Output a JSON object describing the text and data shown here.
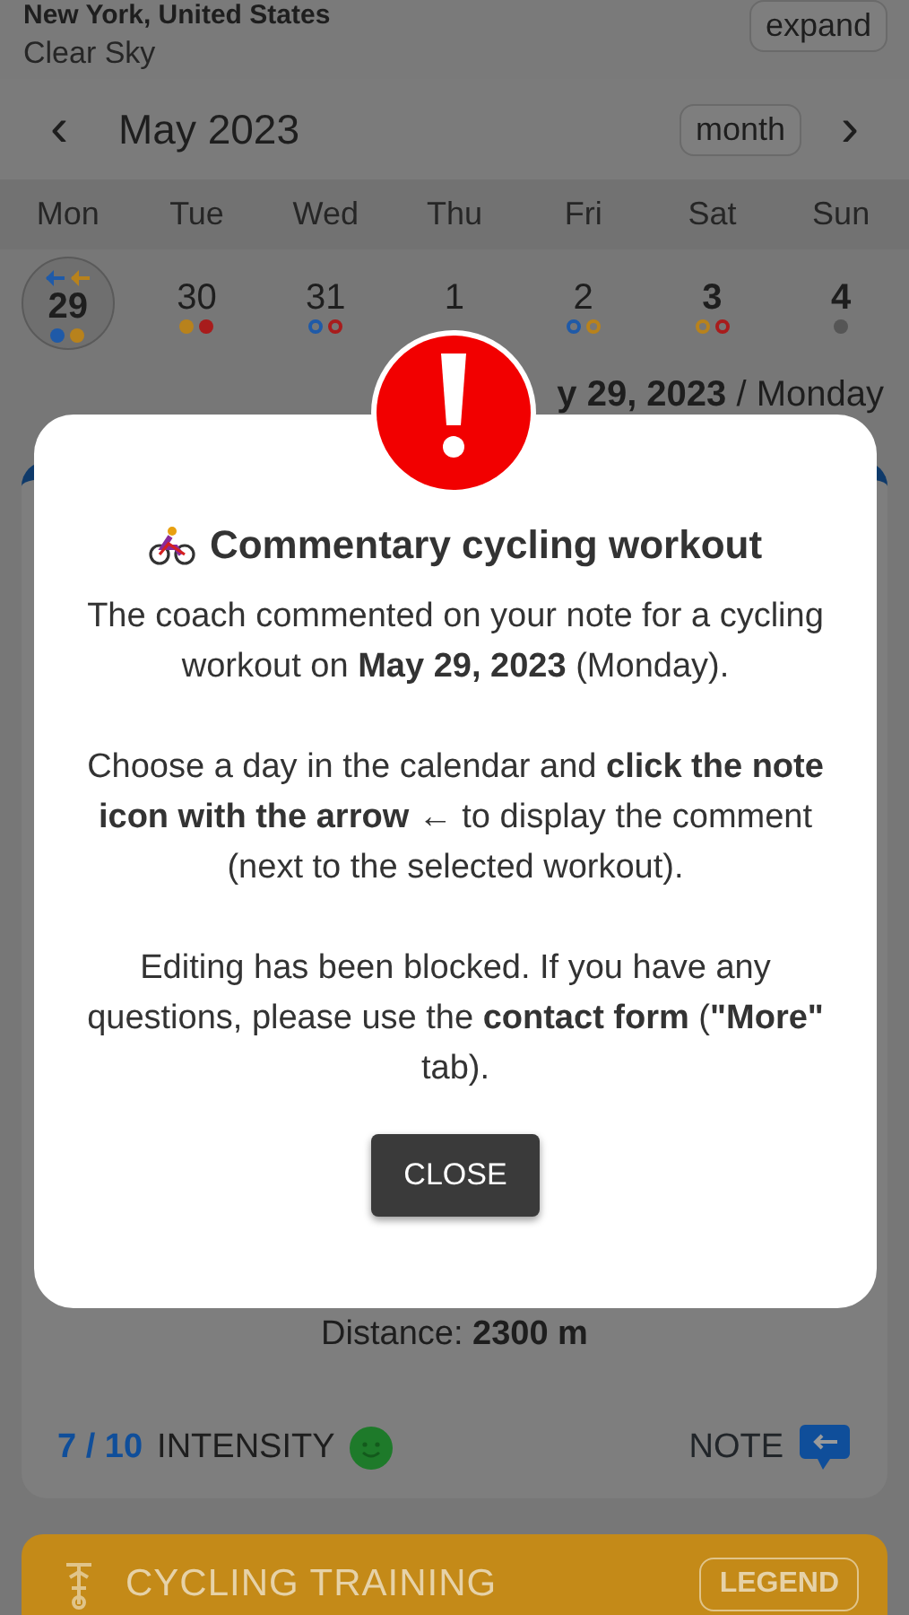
{
  "location": {
    "city": "New York, United States",
    "weather": "Clear Sky",
    "expand_button": "expand"
  },
  "calendar": {
    "prev": "‹",
    "month": "May 2023",
    "view_button": "month",
    "next": "›",
    "weekdays": [
      "Mon",
      "Tue",
      "Wed",
      "Thu",
      "Fri",
      "Sat",
      "Sun"
    ],
    "days": [
      {
        "number": "29",
        "selected": true,
        "bold": true,
        "arrows": [
          {
            "color": "#1f5aa8"
          },
          {
            "color": "#b8821c"
          }
        ],
        "dots": [
          {
            "color": "#1f5aa8",
            "filled": true
          },
          {
            "color": "#b8821c",
            "filled": true
          }
        ]
      },
      {
        "number": "30",
        "selected": false,
        "bold": false,
        "dots": [
          {
            "color": "#b8821c",
            "filled": true
          },
          {
            "color": "#a81c1c",
            "filled": true
          }
        ]
      },
      {
        "number": "31",
        "selected": false,
        "bold": false,
        "dots": [
          {
            "color": "#1f5aa8",
            "filled": false
          },
          {
            "color": "#a81c1c",
            "filled": false
          }
        ]
      },
      {
        "number": "1",
        "selected": false,
        "bold": false
      },
      {
        "number": "2",
        "selected": false,
        "bold": false,
        "dots": [
          {
            "color": "#1f5aa8",
            "filled": false
          },
          {
            "color": "#b8821c",
            "filled": false
          }
        ]
      },
      {
        "number": "3",
        "selected": false,
        "bold": true,
        "dots": [
          {
            "color": "#b8821c",
            "filled": false
          },
          {
            "color": "#a81c1c",
            "filled": false
          }
        ]
      },
      {
        "number": "4",
        "selected": false,
        "bold": true,
        "dots": [
          {
            "color": "#555555",
            "filled": true
          }
        ]
      }
    ]
  },
  "selected_date": "**y 29, 2023** / Monday",
  "workout": {
    "distance": "Distance: **2300 m**",
    "intensity_value": "7 / 10",
    "intensity_label": "INTENSITY",
    "note_label": "NOTE"
  },
  "training_card": {
    "title": "CYCLING TRAINING",
    "legend_button": "LEGEND"
  },
  "modal": {
    "title": "Commentary cycling workout",
    "paragraphs": [
      "The coach commented on your note for a cycling workout on **May 29, 2023** (Monday).",
      "Choose a day in the calendar and **click the note icon with the arrow** ← to display the comment (next to the selected workout).",
      "Editing has been blocked. If you have any questions, please use the **contact form** (**\"More\"** tab)."
    ],
    "close_button": "CLOSE"
  }
}
